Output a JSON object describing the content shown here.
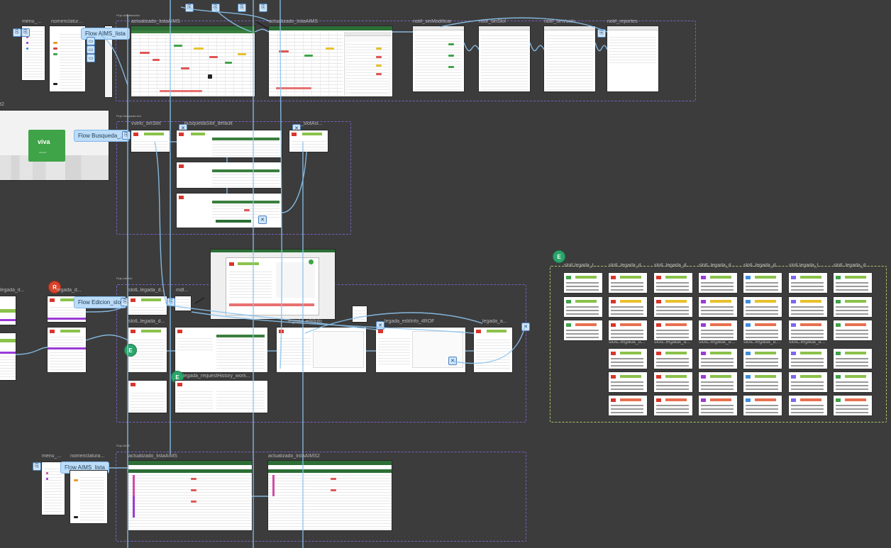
{
  "sections": {
    "top": "Flujo actualización",
    "slot": "Flujo búsqueda slot",
    "edicion": "Flujo edición",
    "aims": "Flujo AIMS",
    "variants": "Variantes",
    "left": "t2"
  },
  "frames": {
    "menu": "menu_...",
    "nomenclatura": "nomenclatur...",
    "act_lista": "actualizado_listaAIMS",
    "act_lista2": "actualizado_listaAIMS",
    "notif1": "notif_sinModificar",
    "notif2": "notif_sinSlot",
    "notif3": "notif_sinVuelo",
    "notif4": "notif_reportes",
    "vuelo": "vuelo_sinSlot",
    "busqueda": "_busquedaSlot_default",
    "slotAsi": "_slotAsi...",
    "legada_d": "legada_d...",
    "slot_legada": "slotL.legada_d...",
    "mdl": "mdl...",
    "legada_edit": "legada_editInfo",
    "legada_4rof": "legada_editInfo_4ROF",
    "legada_a": "legada_a...",
    "slot_legada_row2": "slotL.legada_d...",
    "legada_req": "legada_requestHistory_work...",
    "menu_b": "menu_...",
    "nomenclatura_b": "nomenclatura...",
    "aims_b1": "actualizado_listaAIMS",
    "aims_b2": "actualizado_listaAIMS2",
    "var_labels": [
      "slotLlegada_t...",
      "slotL.legada_d...",
      "slotL.legada_d...",
      "slotL.legada_d...",
      "slotL.legada_d...",
      "slotLlegada_t...",
      "slotL.legada_d..."
    ],
    "var_labels2": [
      "slotL.legada_d...",
      "slotL.legada_d...",
      "slotL.legada_d...",
      "slotL.legada_d...",
      "slotL.legada_d..."
    ],
    "legada_it": "legada_it..."
  },
  "flows": {
    "busqueda": "Flow Busqueda_...",
    "edicion": "Flow Edicion_slot",
    "aims": "Flow AIMS_lista",
    "top": "Flow AIMS_lista"
  },
  "brand": {
    "logo": "viva",
    "tagline": "Viva Air"
  },
  "badges": {
    "e1": "E",
    "e2": "E",
    "e3": "E",
    "r": "R"
  },
  "colors": {
    "canvas": "#3c3c3c",
    "wire": "#8cc4ee",
    "section": "#7a5fc0",
    "green_section": "#a9c46a",
    "brand_green": "#3fa348"
  }
}
